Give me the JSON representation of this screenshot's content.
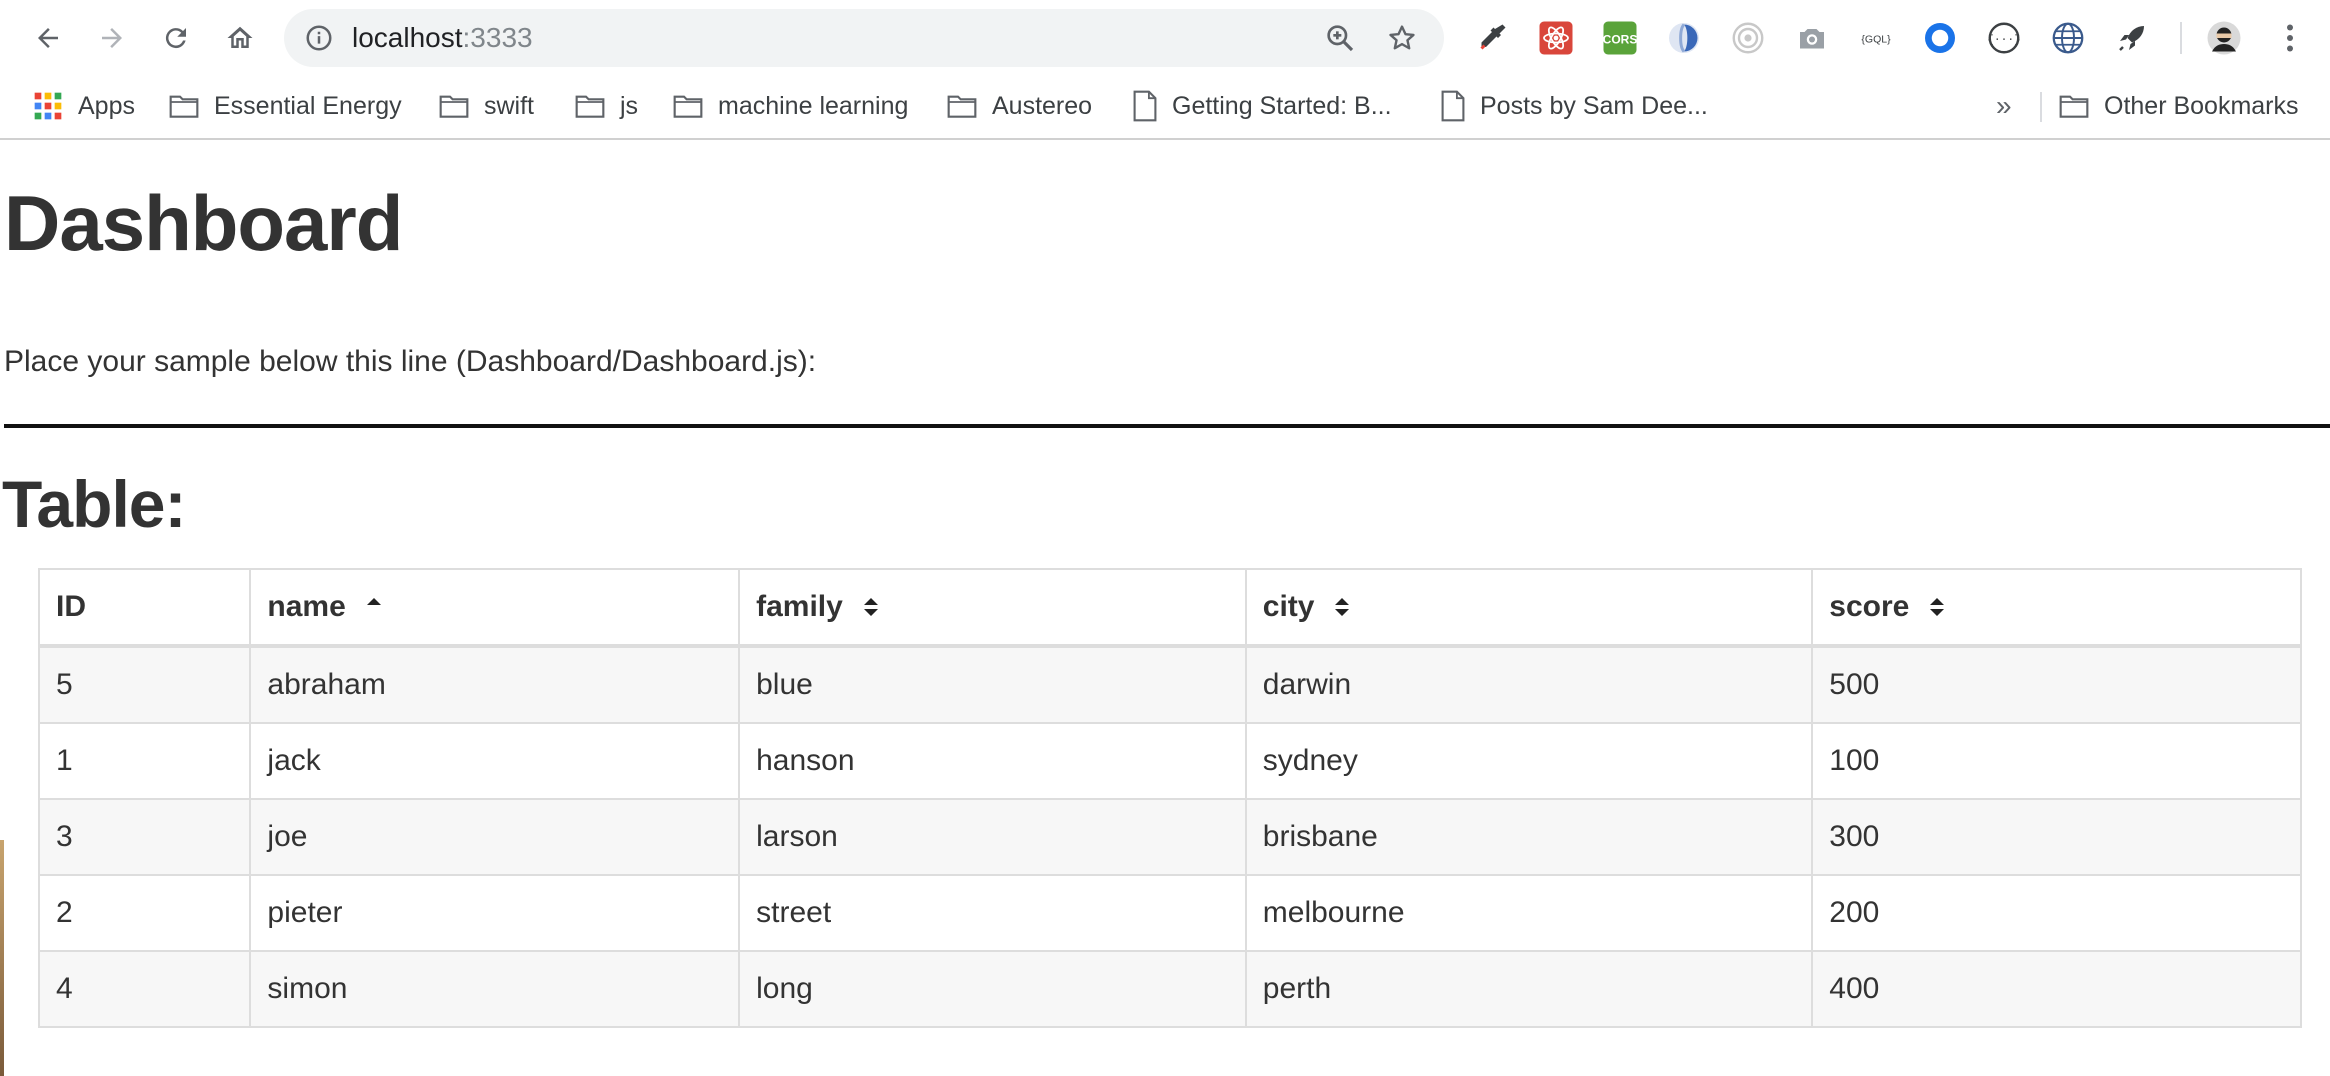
{
  "browser": {
    "url_host": "localhost",
    "url_port": ":3333"
  },
  "bookmarks": [
    {
      "label": "Apps",
      "icon": "apps-grid-icon"
    },
    {
      "label": "Essential Energy",
      "icon": "folder-icon"
    },
    {
      "label": "swift",
      "icon": "folder-icon"
    },
    {
      "label": "js",
      "icon": "folder-icon"
    },
    {
      "label": "machine learning",
      "icon": "folder-icon"
    },
    {
      "label": "Austereo",
      "icon": "folder-icon"
    },
    {
      "label": "Getting Started: B...",
      "icon": "page-icon"
    },
    {
      "label": "Posts by Sam Dee...",
      "icon": "page-icon"
    }
  ],
  "bookmarks_more": "»",
  "other_bookmarks": "Other Bookmarks",
  "extensions": [
    "eyedropper-icon",
    "react-devtools-icon",
    "cors-icon",
    "ext-swirl-icon",
    "ext-target-icon",
    "camera-icon",
    "graphql-icon",
    "ext-ring-icon",
    "json-icon",
    "globe-icon",
    "rocket-icon"
  ],
  "cors_label": "CORS",
  "graphql_label": "{GQL}",
  "page": {
    "title": "Dashboard",
    "intro": "Place your sample below this line (Dashboard/Dashboard.js):",
    "table_heading": "Table:"
  },
  "table": {
    "columns": [
      {
        "label": "ID",
        "sort": "none-hidden"
      },
      {
        "label": "name",
        "sort": "asc"
      },
      {
        "label": "family",
        "sort": "both"
      },
      {
        "label": "city",
        "sort": "both"
      },
      {
        "label": "score",
        "sort": "both"
      }
    ],
    "rows": [
      [
        "5",
        "abraham",
        "blue",
        "darwin",
        "500"
      ],
      [
        "1",
        "jack",
        "hanson",
        "sydney",
        "100"
      ],
      [
        "3",
        "joe",
        "larson",
        "brisbane",
        "300"
      ],
      [
        "2",
        "pieter",
        "street",
        "melbourne",
        "200"
      ],
      [
        "4",
        "simon",
        "long",
        "perth",
        "400"
      ]
    ]
  },
  "colors": {
    "text": "#333333",
    "omnibox": "#f1f3f4",
    "row_stripe": "#f7f7f7",
    "border": "#dddddd"
  }
}
